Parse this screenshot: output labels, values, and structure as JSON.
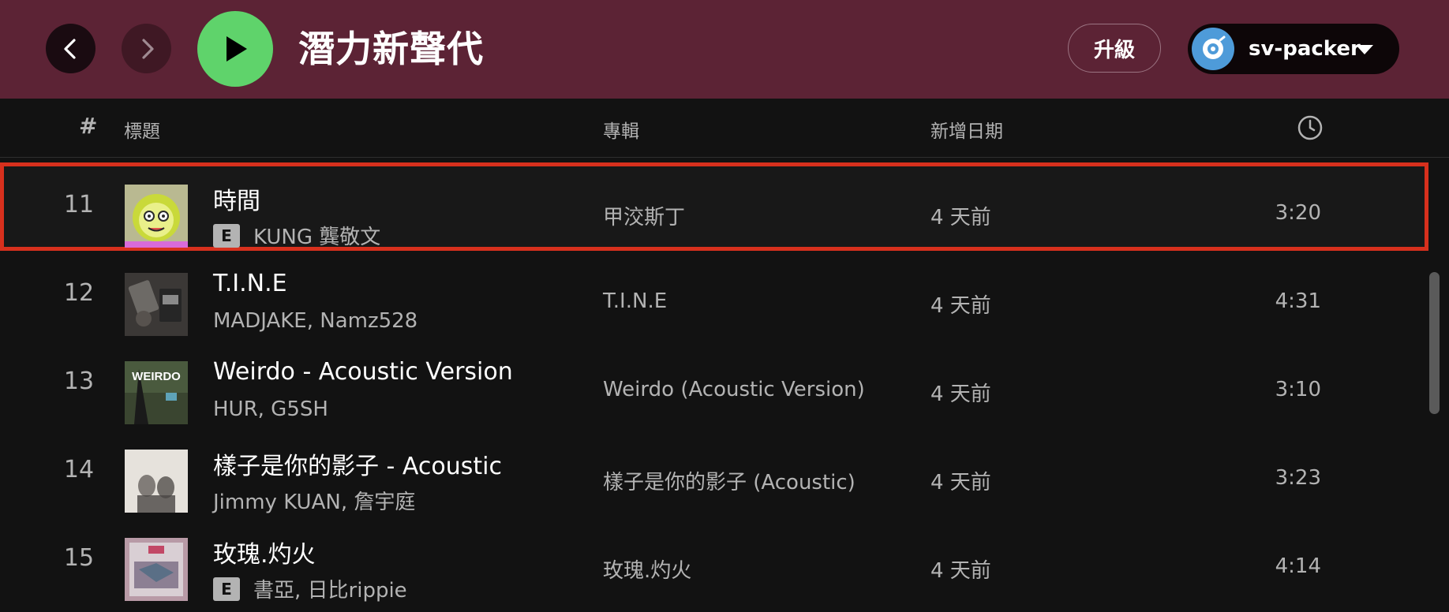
{
  "header": {
    "title": "潛力新聲代",
    "upgrade_label": "升級",
    "username": "sv-packer",
    "background_color": "#5c2335",
    "play_button_color": "#5fd36b",
    "icons": {
      "back": "chevron-left-icon",
      "forward": "chevron-right-icon",
      "play": "play-icon",
      "avatar": "user-avatar-icon",
      "caret": "caret-down-icon"
    }
  },
  "columns": {
    "number": "#",
    "title": "標題",
    "album": "專輯",
    "date_added": "新增日期",
    "duration_icon": "clock-icon"
  },
  "tracks": [
    {
      "number": "11",
      "title": "時間",
      "explicit": true,
      "explicit_label": "E",
      "artists": "KUNG 龔敬文",
      "album": "甲洨斯丁",
      "date_added": "4 天前",
      "duration": "3:20",
      "selected": true
    },
    {
      "number": "12",
      "title": "T.I.N.E",
      "explicit": false,
      "artists": "MADJAKE, Namz528",
      "album": "T.I.N.E",
      "date_added": "4 天前",
      "duration": "4:31",
      "selected": false
    },
    {
      "number": "13",
      "title": "Weirdo - Acoustic Version",
      "explicit": false,
      "artists": "HUR, G5SH",
      "album": "Weirdo (Acoustic Version)",
      "date_added": "4 天前",
      "duration": "3:10",
      "selected": false
    },
    {
      "number": "14",
      "title": "樣子是你的影子 - Acoustic",
      "explicit": false,
      "artists": "Jimmy KUAN, 詹宇庭",
      "album": "樣子是你的影子 (Acoustic)",
      "date_added": "4 天前",
      "duration": "3:23",
      "selected": false
    },
    {
      "number": "15",
      "title": "玫瑰.灼火",
      "explicit": true,
      "explicit_label": "E",
      "artists": "書亞, 日比rippie",
      "album": "玫瑰.灼火",
      "date_added": "4 天前",
      "duration": "4:14",
      "selected": false
    }
  ],
  "cover_art_text": {
    "track_13": "WEIRDO"
  },
  "colors": {
    "selection_outline": "#d7301d",
    "background": "#121212",
    "secondary_text": "#b3b3b3"
  }
}
